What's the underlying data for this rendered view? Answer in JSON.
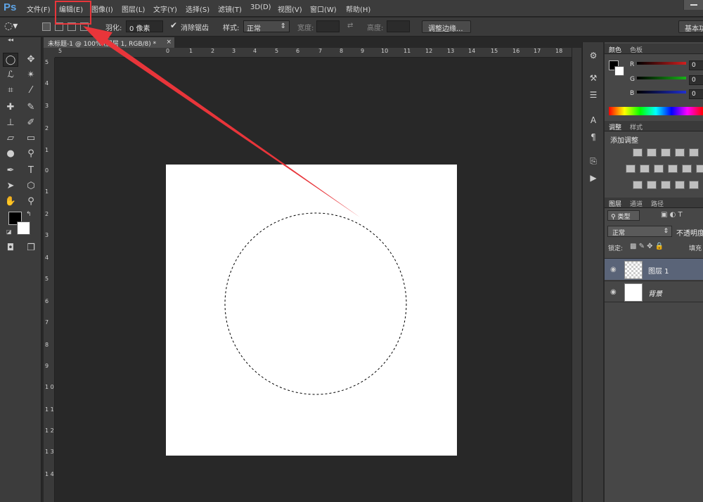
{
  "app": {
    "logo": "Ps"
  },
  "menu": [
    "文件(F)",
    "编辑(E)",
    "图像(I)",
    "图层(L)",
    "文字(Y)",
    "选择(S)",
    "滤镜(T)",
    "3D(D)",
    "视图(V)",
    "窗口(W)",
    "帮助(H)"
  ],
  "options": {
    "feather_label": "羽化:",
    "feather_value": "0 像素",
    "antialias_label": "消除锯齿",
    "style_label": "样式:",
    "style_value": "正常",
    "width_label": "宽度:",
    "height_label": "高度:",
    "refine_button": "调整边缘...",
    "workspace_button": "基本功"
  },
  "document": {
    "tab_title": "未标题-1 @ 100% (图层 1, RGB/8) *"
  },
  "ruler_top": [
    "5",
    "0",
    "1",
    "2",
    "3",
    "4",
    "5",
    "6",
    "7",
    "8",
    "9",
    "10",
    "11",
    "12",
    "13",
    "14",
    "15",
    "16",
    "17",
    "18"
  ],
  "ruler_left": [
    "5",
    "4",
    "3",
    "2",
    "1",
    "0",
    "1",
    "2",
    "3",
    "4",
    "5",
    "6",
    "7",
    "8",
    "9",
    "1 0",
    "1 1",
    "1 2",
    "1 3",
    "1 4"
  ],
  "color_panel": {
    "tabs": [
      "颜色",
      "色板"
    ],
    "channels": [
      {
        "label": "R",
        "value": "0",
        "color": "#d11f1f"
      },
      {
        "label": "G",
        "value": "0",
        "color": "#17b317"
      },
      {
        "label": "B",
        "value": "0",
        "color": "#1f2fd1"
      }
    ]
  },
  "adjust_panel": {
    "tabs": [
      "调整",
      "样式"
    ],
    "title": "添加调整"
  },
  "layers_panel": {
    "tabs": [
      "图层",
      "通道",
      "路径"
    ],
    "kind_filter": "类型",
    "blend_mode": "正常",
    "opacity_label": "不透明度",
    "lock_label": "锁定:",
    "fill_label": "填充",
    "layers": [
      {
        "name": "图层 1",
        "selected": true
      },
      {
        "name": "背景",
        "selected": false
      }
    ]
  },
  "colors": {
    "accent": "#e8353a",
    "selection_highlight": "#e8353a",
    "logo": "#5ea4e6"
  }
}
